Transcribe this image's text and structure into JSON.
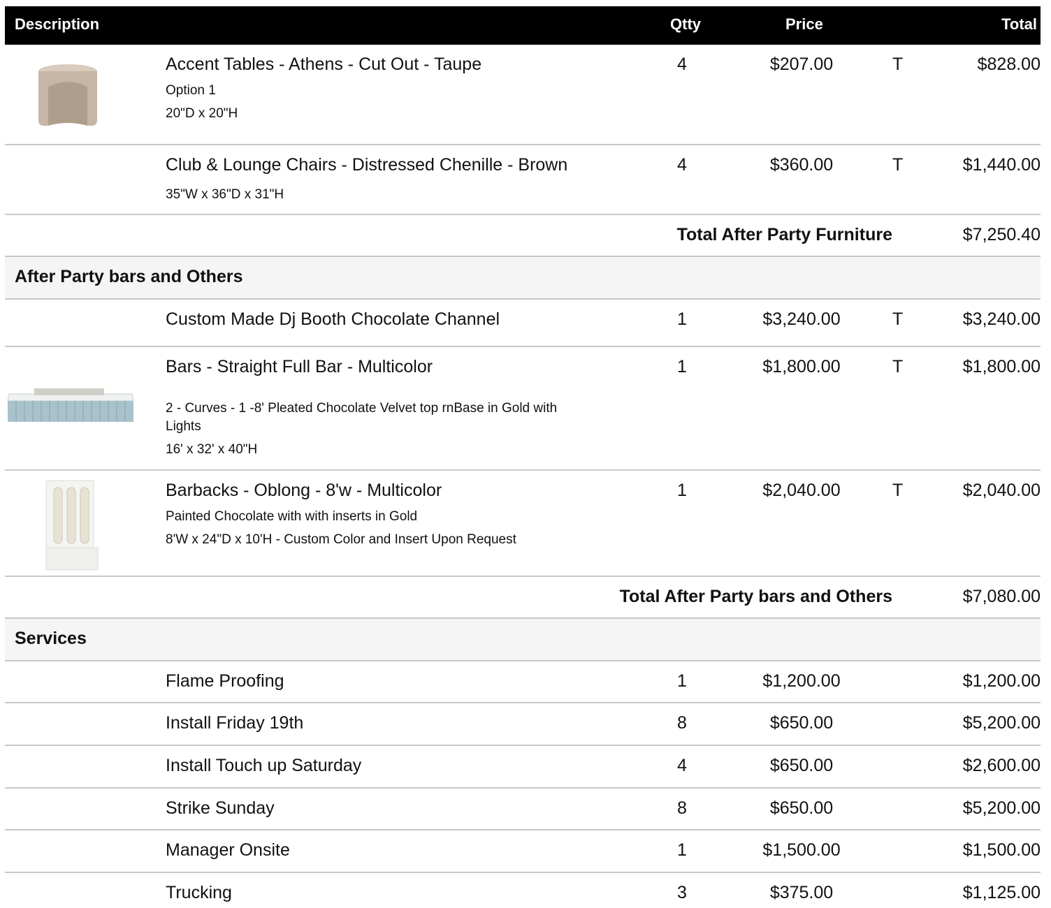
{
  "header": {
    "description": "Description",
    "qty": "Qtty",
    "price": "Price",
    "total": "Total"
  },
  "items1": [
    {
      "name": "Accent Tables - Athens - Cut Out - Taupe",
      "sub1": "Option 1",
      "sub2": "20\"D x 20\"H",
      "qty": "4",
      "price": "$207.00",
      "tax": "T",
      "total": "$828.00",
      "image": "accent-table"
    },
    {
      "name": "Club & Lounge Chairs - Distressed Chenille - Brown",
      "sub1": "35\"W x 36\"D x 31\"H",
      "qty": "4",
      "price": "$360.00",
      "tax": "T",
      "total": "$1,440.00"
    }
  ],
  "subtotal1": {
    "label": "Total After Party Furniture",
    "value": "$7,250.40"
  },
  "section2": {
    "title": "After Party bars and Others"
  },
  "items2": [
    {
      "name": "Custom Made Dj Booth Chocolate Channel",
      "qty": "1",
      "price": "$3,240.00",
      "tax": "T",
      "total": "$3,240.00"
    },
    {
      "name": "Bars - Straight Full Bar - Multicolor",
      "sub1": "2 - Curves - 1 -8' Pleated Chocolate Velvet top rnBase in Gold  with",
      "sub2": "Lights",
      "sub3": "16' x 32' x 40\"H",
      "qty": "1",
      "price": "$1,800.00",
      "tax": "T",
      "total": "$1,800.00",
      "image": "full-bar"
    },
    {
      "name": "Barbacks - Oblong - 8'w - Multicolor",
      "sub1": "Painted Chocolate with with inserts in Gold",
      "sub2": "8'W x 24\"D x 10'H - Custom Color and Insert Upon Request",
      "qty": "1",
      "price": "$2,040.00",
      "tax": "T",
      "total": "$2,040.00",
      "image": "barback"
    }
  ],
  "subtotal2": {
    "label": "Total After Party bars and Others",
    "value": "$7,080.00"
  },
  "section3": {
    "title": "Services"
  },
  "services": [
    {
      "name": "Flame Proofing",
      "qty": "1",
      "price": "$1,200.00",
      "total": "$1,200.00"
    },
    {
      "name": "Install Friday 19th",
      "qty": "8",
      "price": "$650.00",
      "total": "$5,200.00"
    },
    {
      "name": "Install Touch up Saturday",
      "qty": "4",
      "price": "$650.00",
      "total": "$2,600.00"
    },
    {
      "name": "Strike Sunday",
      "qty": "8",
      "price": "$650.00",
      "total": "$5,200.00"
    },
    {
      "name": "Manager Onsite",
      "qty": "1",
      "price": "$1,500.00",
      "total": "$1,500.00"
    },
    {
      "name": "Trucking",
      "qty": "3",
      "price": "$375.00",
      "total": "$1,125.00"
    }
  ]
}
